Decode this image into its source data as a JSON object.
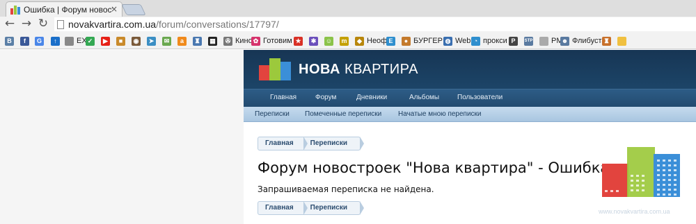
{
  "browser": {
    "tab": {
      "title": "Ошибка | Форум новостр",
      "close": "×"
    },
    "nav": {
      "back": "←",
      "forward": "→",
      "reload": "↻"
    },
    "url": {
      "host": "novakvartira.com.ua",
      "path": "/forum/conversations/17797/"
    },
    "bookmarks": [
      {
        "icon": "vk-icon",
        "label": "",
        "glyph": "В",
        "color": "#5b7fa6"
      },
      {
        "icon": "facebook-icon",
        "label": "",
        "glyph": "f",
        "color": "#3b5998"
      },
      {
        "icon": "translate-icon",
        "label": "",
        "glyph": "G",
        "color": "#4a86e8"
      },
      {
        "icon": "arrow-up-icon",
        "label": "",
        "glyph": "↑",
        "color": "#1a6fc9"
      },
      {
        "icon": "ex-icon",
        "label": "EX",
        "glyph": "",
        "color": "#888888"
      },
      {
        "icon": "maps-icon",
        "label": "",
        "glyph": "✓",
        "color": "#34a853"
      },
      {
        "icon": "youtube-icon",
        "label": "",
        "glyph": "▶",
        "color": "#e62117"
      },
      {
        "icon": "box-icon",
        "label": "",
        "glyph": "■",
        "color": "#c98a2b"
      },
      {
        "icon": "instagram-icon",
        "label": "",
        "glyph": "◉",
        "color": "#7a5a3a"
      },
      {
        "icon": "telegram-icon",
        "label": "",
        "glyph": "➤",
        "color": "#3c8fc4"
      },
      {
        "icon": "mail-icon",
        "label": "",
        "glyph": "✉",
        "color": "#6aa84f"
      },
      {
        "icon": "amazon-icon",
        "label": "",
        "glyph": "a",
        "color": "#f08a1c"
      },
      {
        "icon": "elephant-icon",
        "label": "",
        "glyph": "♜",
        "color": "#4a78b0"
      },
      {
        "icon": "tv-icon",
        "label": "",
        "glyph": "▦",
        "color": "#222222"
      },
      {
        "icon": "film-icon",
        "label": "Кино",
        "glyph": "✇",
        "color": "#777777"
      },
      {
        "icon": "cooking-icon",
        "label": "Готовим",
        "glyph": "✿",
        "color": "#d6336c"
      },
      {
        "icon": "star-badge-icon",
        "label": "",
        "glyph": "★",
        "color": "#d93025"
      },
      {
        "icon": "puzzle-icon",
        "label": "",
        "glyph": "✱",
        "color": "#6b4fbb"
      },
      {
        "icon": "android-icon",
        "label": "",
        "glyph": "☺",
        "color": "#8bc34a"
      },
      {
        "icon": "m-icon",
        "label": "",
        "glyph": "m",
        "color": "#c4a000"
      },
      {
        "icon": "neof-icon",
        "label": "Неоф",
        "glyph": "◆",
        "color": "#b8860b"
      },
      {
        "icon": "evernote-icon",
        "label": "",
        "glyph": "E",
        "color": "#2f8fce"
      },
      {
        "icon": "burger-icon",
        "label": "БУРГЕР",
        "glyph": "●",
        "color": "#c47a2c"
      },
      {
        "icon": "globe-icon",
        "label": "Web",
        "glyph": "◍",
        "color": "#3a6fb0"
      },
      {
        "icon": "proxy-icon",
        "label": "прокси",
        "glyph": "◔",
        "color": "#2f8fce"
      },
      {
        "icon": "p-icon",
        "label": "",
        "glyph": "P",
        "color": "#444444"
      },
      {
        "icon": "stp-icon",
        "label": "",
        "glyph": "STP",
        "color": "#5a7aa0"
      },
      {
        "icon": "page-icon",
        "label": "PM",
        "glyph": "",
        "color": "#aaaaaa"
      },
      {
        "icon": "flibusta-icon",
        "label": "Флибуста",
        "glyph": "☻",
        "color": "#5a7aa0"
      },
      {
        "icon": "castle-icon",
        "label": "",
        "glyph": "♜",
        "color": "#c8702a"
      },
      {
        "icon": "folder-icon",
        "label": "",
        "glyph": "",
        "color": "#f0c040"
      }
    ]
  },
  "site": {
    "logo": {
      "bold": "НОВА",
      "regular": "КВАРТИРА"
    },
    "nav": [
      "Главная",
      "Форум",
      "Дневники",
      "Альбомы",
      "Пользователи"
    ],
    "subnav": [
      "Переписки",
      "Помеченные переписки",
      "Начатые мною переписки"
    ],
    "breadcrumb": [
      "Главная",
      "Переписки"
    ],
    "page_title": "Форум новостроек \"Нова квартира\" - Ошибка",
    "message": "Запрашиваемая переписка не найдена.",
    "watermark": "www.novakvartira.com.ua"
  },
  "colors": {
    "header_bg": "#1c4568",
    "nav_bg": "#2d5c86",
    "subnav_bg": "#b8d1e8",
    "building_red": "#e2443e",
    "building_green": "#9cc93c",
    "building_blue": "#3b8fd8"
  }
}
